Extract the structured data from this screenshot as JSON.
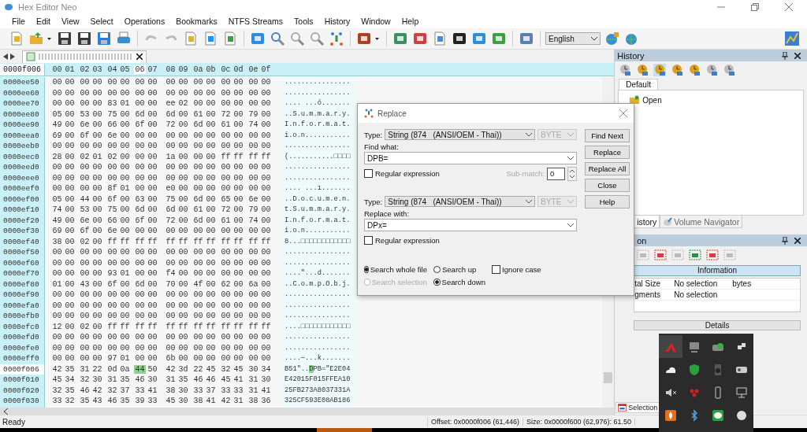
{
  "window": {
    "title": "Hex Editor Neo"
  },
  "menu": [
    "File",
    "Edit",
    "View",
    "Select",
    "Operations",
    "Bookmarks",
    "NTFS Streams",
    "Tools",
    "History",
    "Window",
    "Help"
  ],
  "toolbar": {
    "language": "English"
  },
  "editor": {
    "offset_header": "0000f006",
    "columns": [
      {
        "label": "00",
        "selected": false
      },
      {
        "label": "01",
        "selected": false
      },
      {
        "label": "02",
        "selected": false
      },
      {
        "label": "03",
        "selected": false
      },
      {
        "label": "04",
        "selected": false
      },
      {
        "label": "05",
        "selected": false
      },
      {
        "label": "06",
        "selected": true
      },
      {
        "label": "07",
        "selected": false
      },
      {
        "label": "08",
        "selected": false
      },
      {
        "label": "09",
        "selected": false
      },
      {
        "label": "0a",
        "selected": false
      },
      {
        "label": "0b",
        "selected": false
      },
      {
        "label": "0c",
        "selected": false
      },
      {
        "label": "0d",
        "selected": false
      },
      {
        "label": "0e",
        "selected": false
      },
      {
        "label": "0f",
        "selected": false
      }
    ],
    "rows": [
      {
        "offset": "0000ee50",
        "current": false,
        "hex": "00 00 00 00 00 00 00 00 00 00 00 00 00 00 00 00",
        "ascii": "................"
      },
      {
        "offset": "0000ee60",
        "current": false,
        "hex": "00 00 00 00 00 00 00 00 00 00 00 00 00 00 00 00",
        "ascii": "................"
      },
      {
        "offset": "0000ee70",
        "current": false,
        "hex": "00 00 00 00 83 01 00 00 ee 02 00 00 00 00 00 00",
        "ascii": ".... ...ó......."
      },
      {
        "offset": "0000ee80",
        "current": false,
        "hex": "05 00 53 00 75 00 6d 00 6d 00 61 00 72 00 79 00",
        "ascii": "..S.u.m.m.a.r.y."
      },
      {
        "offset": "0000ee90",
        "current": false,
        "hex": "49 00 6e 00 66 00 6f 00 72 00 6d 00 61 00 74 00",
        "ascii": "I.n.f.o.r.m.a.t."
      },
      {
        "offset": "0000eea0",
        "current": false,
        "hex": "69 00 6f 00 6e 00 00 00 00 00 00 00 00 00 00 00",
        "ascii": "i.o.n..........."
      },
      {
        "offset": "0000eeb0",
        "current": false,
        "hex": "00 00 00 00 00 00 00 00 00 00 00 00 00 00 00 00",
        "ascii": "................"
      },
      {
        "offset": "0000eec0",
        "current": false,
        "hex": "28 00 02 01 02 00 00 00 1a 00 00 00 ff ff ff ff",
        "ascii": "(...........□□□□"
      },
      {
        "offset": "0000eed0",
        "current": false,
        "hex": "00 00 00 00 00 00 00 00 00 00 00 00 00 00 00 00",
        "ascii": "................"
      },
      {
        "offset": "0000eee0",
        "current": false,
        "hex": "00 00 00 00 00 00 00 00 00 00 00 00 00 00 00 00",
        "ascii": "................"
      },
      {
        "offset": "0000eef0",
        "current": false,
        "hex": "00 00 00 00 8f 01 00 00 e0 00 00 00 00 00 00 00",
        "ascii": ".... ...ı......."
      },
      {
        "offset": "0000ef00",
        "current": false,
        "hex": "05 00 44 00 6f 00 63 00 75 00 6d 00 65 00 6e 00",
        "ascii": "..D.o.c.u.m.e.n."
      },
      {
        "offset": "0000ef10",
        "current": false,
        "hex": "74 00 53 00 75 00 6d 00 6d 00 61 00 72 00 79 00",
        "ascii": "t.S.u.m.m.a.r.y."
      },
      {
        "offset": "0000ef20",
        "current": false,
        "hex": "49 00 6e 00 66 00 6f 00 72 00 6d 00 61 00 74 00",
        "ascii": "I.n.f.o.r.m.a.t."
      },
      {
        "offset": "0000ef30",
        "current": false,
        "hex": "69 00 6f 00 6e 00 00 00 00 00 00 00 00 00 00 00",
        "ascii": "i.o.n..........."
      },
      {
        "offset": "0000ef40",
        "current": false,
        "hex": "38 00 02 00 ff ff ff ff ff ff ff ff ff ff ff ff",
        "ascii": "8...□□□□□□□□□□□□"
      },
      {
        "offset": "0000ef50",
        "current": false,
        "hex": "00 00 00 00 00 00 00 00 00 00 00 00 00 00 00 00",
        "ascii": "................"
      },
      {
        "offset": "0000ef60",
        "current": false,
        "hex": "00 00 00 00 00 00 00 00 00 00 00 00 00 00 00 00",
        "ascii": "................"
      },
      {
        "offset": "0000ef70",
        "current": false,
        "hex": "00 00 00 00 93 01 00 00 f4 00 00 00 00 00 00 00",
        "ascii": "....\"...d......."
      },
      {
        "offset": "0000ef80",
        "current": false,
        "hex": "01 00 43 00 6f 00 6d 00 70 00 4f 00 62 00 6a 00",
        "ascii": "..C.o.m.p.O.b.j."
      },
      {
        "offset": "0000ef90",
        "current": false,
        "hex": "00 00 00 00 00 00 00 00 00 00 00 00 00 00 00 00",
        "ascii": "................"
      },
      {
        "offset": "0000efa0",
        "current": false,
        "hex": "00 00 00 00 00 00 00 00 00 00 00 00 00 00 00 00",
        "ascii": "................"
      },
      {
        "offset": "0000efb0",
        "current": false,
        "hex": "00 00 00 00 00 00 00 00 00 00 00 00 00 00 00 00",
        "ascii": "................"
      },
      {
        "offset": "0000efc0",
        "current": false,
        "hex": "12 00 02 00 ff ff ff ff ff ff ff ff ff ff ff ff",
        "ascii": "....□□□□□□□□□□□□"
      },
      {
        "offset": "0000efd0",
        "current": false,
        "hex": "00 00 00 00 00 00 00 00 00 00 00 00 00 00 00 00",
        "ascii": "................"
      },
      {
        "offset": "0000efe0",
        "current": false,
        "hex": "00 00 00 00 00 00 00 00 00 00 00 00 00 00 00 00",
        "ascii": "................"
      },
      {
        "offset": "0000eff0",
        "current": false,
        "hex": "00 00 00 00 97 01 00 00 6b 00 00 00 00 00 00 00",
        "ascii": "....—...k......."
      },
      {
        "offset": "0000f006",
        "current": true,
        "hex_parts": [
          {
            "text": "42 35 31 22 0d 0a",
            "selected": false
          },
          {
            "text": "44",
            "selected": true
          },
          {
            "text": "50 42 3d 22 45 32 45 30 34",
            "selected": false
          }
        ],
        "ascii_parts": [
          {
            "text": "B51\"..",
            "selected": false
          },
          {
            "text": "D",
            "selected": true
          },
          {
            "text": "PB=\"E2E04",
            "selected": false
          }
        ]
      },
      {
        "offset": "0000f010",
        "current": false,
        "hex": "45 34 32 30 31 35 46 30 31 35 46 46 45 41 31 30",
        "ascii": "E42015F015FFEA10"
      },
      {
        "offset": "0000f020",
        "current": false,
        "hex": "32 35 46 42 32 37 33 41 38 30 33 37 33 33 31 41",
        "ascii": "25FB273A8037331A"
      },
      {
        "offset": "0000f030",
        "current": false,
        "hex": "33 32 35 43 46 35 39 33 45 30 38 41 42 31 38 36",
        "ascii": "325CF593E08AB186"
      }
    ]
  },
  "history_panel": {
    "title": "History",
    "tab": "Default",
    "items": [
      "Open"
    ],
    "bottom_tabs": [
      {
        "label": "istory",
        "selected": true
      },
      {
        "label": "Volume Navigator",
        "selected": false
      }
    ]
  },
  "selection_panel": {
    "title": "on",
    "info_header": "Information",
    "info_rows": [
      [
        "tal Size",
        "No selection",
        "bytes"
      ],
      [
        "gments",
        "No selection"
      ]
    ],
    "details": "Details",
    "tab": "Selection"
  },
  "dialog": {
    "title": "Replace",
    "find": {
      "type_label": "Type:",
      "type": "String (874   (ANSI/OEM - Thai))",
      "unit": "BYTE",
      "label": "Find what:",
      "value": "DPB=",
      "regex": {
        "label": "Regular expression",
        "checked": false
      },
      "submatch": {
        "label": "Sub-match:",
        "value": "0"
      }
    },
    "replace": {
      "type_label": "Type:",
      "type": "String (874   (ANSI/OEM - Thai))",
      "unit": "BYTE",
      "label": "Replace with:",
      "value": "DPx=",
      "regex": {
        "label": "Regular expression",
        "checked": false
      }
    },
    "scope": [
      {
        "label": "Search whole file",
        "selected": true,
        "disabled": false
      },
      {
        "label": "Search selection",
        "selected": false,
        "disabled": true
      }
    ],
    "direction": [
      {
        "label": "Search up",
        "selected": false
      },
      {
        "label": "Search down",
        "selected": true
      }
    ],
    "ignore_case": {
      "label": "Ignore case",
      "checked": false
    },
    "buttons": [
      "Find Next",
      "Replace",
      "Replace All",
      "Close",
      "Help"
    ]
  },
  "status_bar": [
    "Ready",
    "Offset: 0x0000f006 (61,446)",
    "Size: 0x0000f600 (62,976): 61.50"
  ]
}
